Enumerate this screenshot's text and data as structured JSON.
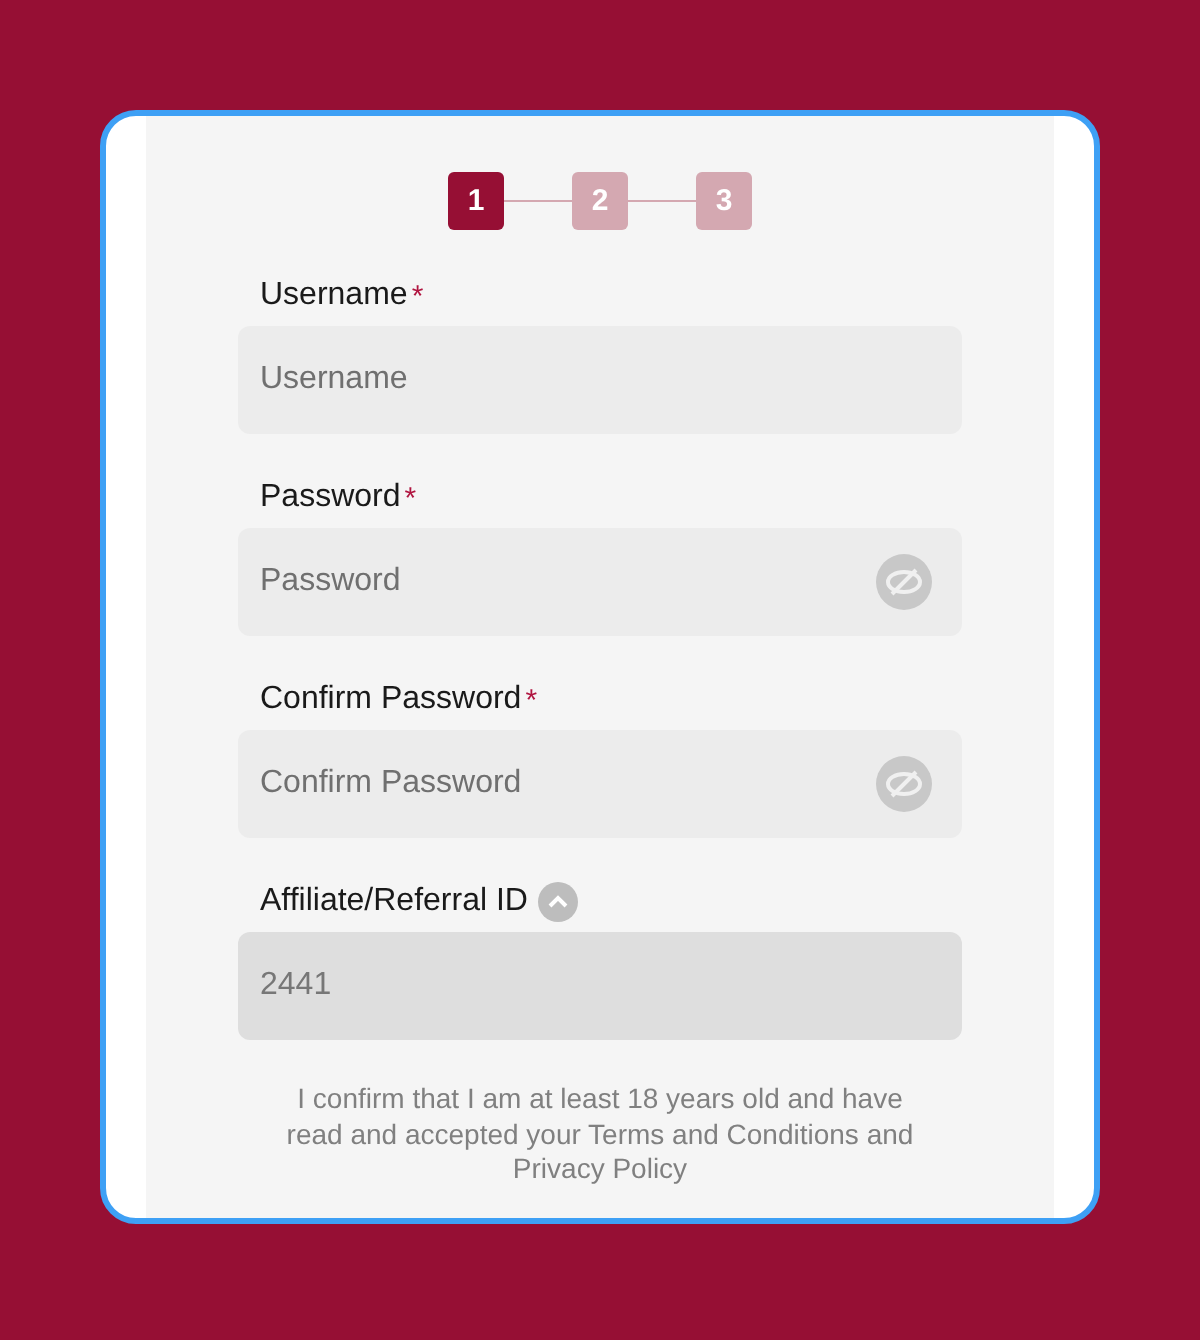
{
  "steps": [
    {
      "label": "1",
      "selected": true
    },
    {
      "label": "2",
      "selected": false
    },
    {
      "label": "3",
      "selected": false
    }
  ],
  "fields": [
    {
      "kind": "text",
      "label": "Username",
      "required": true,
      "disabled": false,
      "placeholder": "Username"
    },
    {
      "kind": "password",
      "label": "Password",
      "required": true,
      "disabled": false,
      "placeholder": "Password"
    },
    {
      "kind": "password",
      "label": "Confirm Password",
      "required": true,
      "disabled": false,
      "placeholder": "Confirm Password"
    },
    {
      "kind": "collapsible",
      "label": "Affiliate/Referral ID",
      "required": false,
      "expanded": true,
      "value": "2441",
      "disabled": true
    }
  ],
  "required_mark": "*",
  "terms_text": "I confirm that I am at least 18 years old and have read and accepted your Terms and Conditions and Privacy Policy"
}
